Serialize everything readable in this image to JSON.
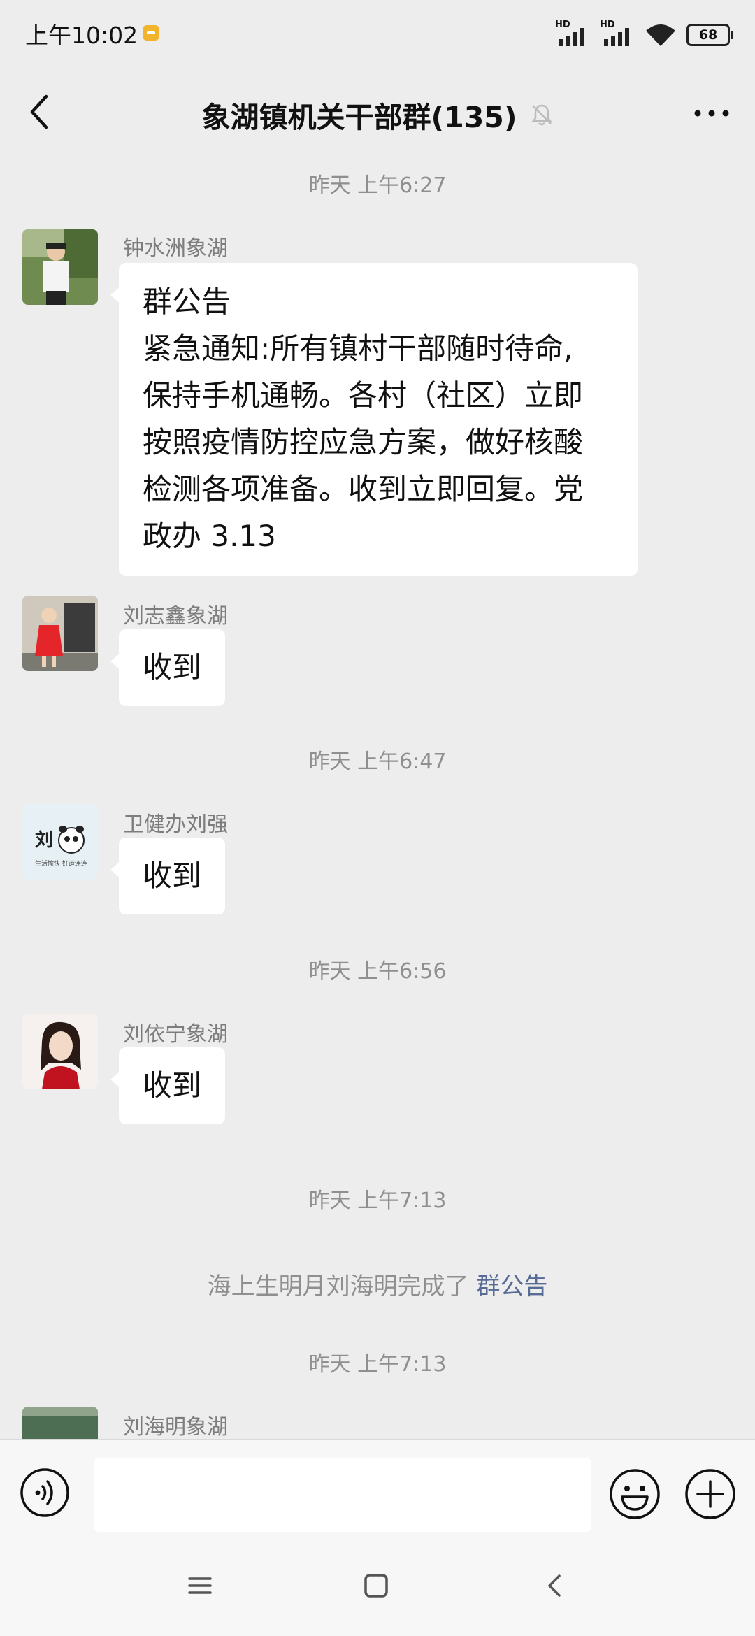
{
  "status_bar": {
    "time": "上午10:02",
    "hd_label": "HD",
    "battery": "68"
  },
  "header": {
    "title": "象湖镇机关干部群(135)"
  },
  "messages": [
    {
      "type": "time",
      "text": "昨天 上午6:27"
    },
    {
      "type": "msg",
      "sender": "钟水洲象湖",
      "lines": [
        "群公告",
        "紧急通知:所有镇村干部随时待命,",
        "保持手机通畅。各村（社区）立即",
        "按照疫情防控应急方案，做好核酸",
        "检测各项准备。收到立即回复。党",
        "政办 3.13"
      ]
    },
    {
      "type": "msg",
      "sender": "刘志鑫象湖",
      "text": "收到"
    },
    {
      "type": "time",
      "text": "昨天 上午6:47"
    },
    {
      "type": "msg",
      "sender": "卫健办刘强",
      "text": "收到",
      "avatar_text": "刘",
      "avatar_caption": "生活愉快 好运连连"
    },
    {
      "type": "time",
      "text": "昨天 上午6:56"
    },
    {
      "type": "msg",
      "sender": "刘依宁象湖",
      "text": "收到"
    },
    {
      "type": "time",
      "text": "昨天 上午7:13"
    },
    {
      "type": "system",
      "text": "海上生明月刘海明完成了 ",
      "link": "群公告"
    },
    {
      "type": "time",
      "text": "昨天 上午7:13"
    },
    {
      "type": "msg",
      "sender": "刘海明象湖"
    }
  ],
  "colors": {
    "background": "#ededed",
    "bubble": "#ffffff",
    "link": "#576b95",
    "meta_text": "#8f8f8f"
  },
  "icons": [
    "back-arrow-icon",
    "mute-bell-icon",
    "more-icon",
    "voice-icon",
    "emoji-icon",
    "plus-icon",
    "menu-icon",
    "home-icon",
    "back-nav-icon"
  ]
}
